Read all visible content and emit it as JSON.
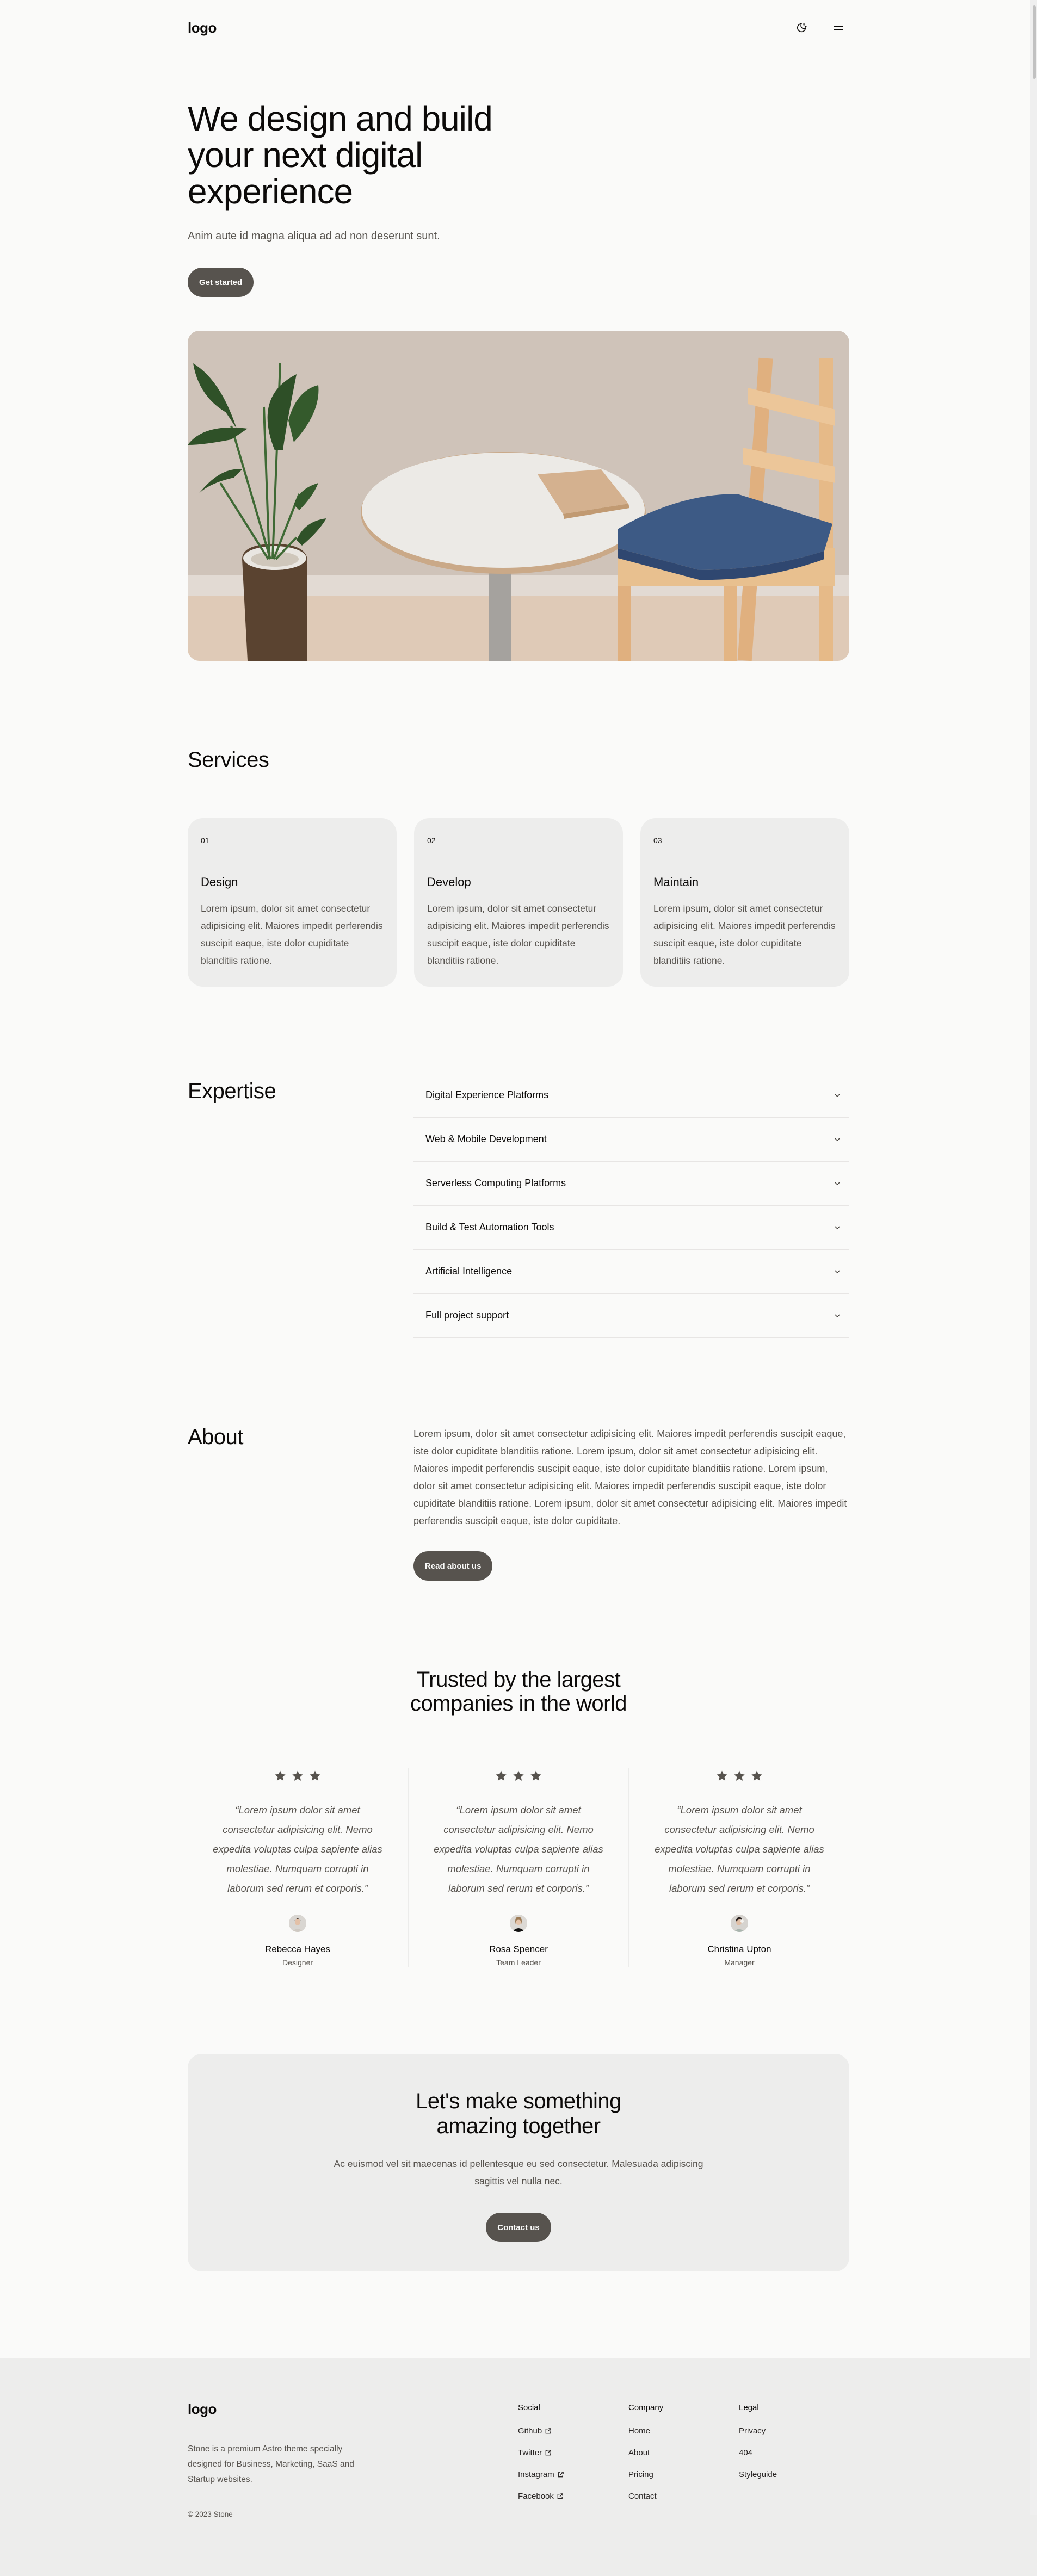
{
  "header": {
    "logo": "logo",
    "theme_toggle_icon": "moon-stars-icon",
    "menu_icon": "hamburger-menu-icon"
  },
  "hero": {
    "title": "We design and build your next digital experience",
    "subtitle": "Anim aute id magna aliqua ad ad non deserunt sunt.",
    "cta_label": "Get started",
    "image_alt": "Round white table with a closed laptop, a potted plant and a wooden chair with a blue cushion"
  },
  "services": {
    "title": "Services",
    "cards": [
      {
        "number": "01",
        "title": "Design",
        "body": "Lorem ipsum, dolor sit amet consectetur adipisicing elit. Maiores impedit perferendis suscipit eaque, iste dolor cupiditate blanditiis ratione."
      },
      {
        "number": "02",
        "title": "Develop",
        "body": "Lorem ipsum, dolor sit amet consectetur adipisicing elit. Maiores impedit perferendis suscipit eaque, iste dolor cupiditate blanditiis ratione."
      },
      {
        "number": "03",
        "title": "Maintain",
        "body": "Lorem ipsum, dolor sit amet consectetur adipisicing elit. Maiores impedit perferendis suscipit eaque, iste dolor cupiditate blanditiis ratione."
      }
    ]
  },
  "expertise": {
    "title": "Expertise",
    "items": [
      {
        "label": "Digital Experience Platforms"
      },
      {
        "label": "Web & Mobile Development"
      },
      {
        "label": "Serverless Computing Platforms"
      },
      {
        "label": "Build & Test Automation Tools"
      },
      {
        "label": "Artificial Intelligence"
      },
      {
        "label": "Full project support"
      }
    ]
  },
  "about": {
    "title": "About",
    "body": "Lorem ipsum, dolor sit amet consectetur adipisicing elit. Maiores impedit perferendis suscipit eaque, iste dolor cupiditate blanditiis ratione. Lorem ipsum, dolor sit amet consectetur adipisicing elit. Maiores impedit perferendis suscipit eaque, iste dolor cupiditate blanditiis ratione. Lorem ipsum, dolor sit amet consectetur adipisicing elit. Maiores impedit perferendis suscipit eaque, iste dolor cupiditate blanditiis ratione. Lorem ipsum, dolor sit amet consectetur adipisicing elit. Maiores impedit perferendis suscipit eaque, iste dolor cupiditate.",
    "cta_label": "Read about us"
  },
  "testimonials": {
    "title": "Trusted by the largest companies in the world",
    "items": [
      {
        "rating": 3,
        "quote": "“Lorem ipsum dolor sit amet consectetur adipisicing elit. Nemo expedita voluptas culpa sapiente alias molestiae. Numquam corrupti in laborum sed rerum et corporis.”",
        "name": "Rebecca Hayes",
        "role": "Designer"
      },
      {
        "rating": 3,
        "quote": "“Lorem ipsum dolor sit amet consectetur adipisicing elit. Nemo expedita voluptas culpa sapiente alias molestiae. Numquam corrupti in laborum sed rerum et corporis.”",
        "name": "Rosa Spencer",
        "role": "Team Leader"
      },
      {
        "rating": 3,
        "quote": "“Lorem ipsum dolor sit amet consectetur adipisicing elit. Nemo expedita voluptas culpa sapiente alias molestiae. Numquam corrupti in laborum sed rerum et corporis.”",
        "name": "Christina Upton",
        "role": "Manager"
      }
    ]
  },
  "cta": {
    "title": "Let's make something amazing together",
    "body": "Ac euismod vel sit maecenas id pellentesque eu sed consectetur. Malesuada adipiscing sagittis vel nulla nec.",
    "button_label": "Contact us"
  },
  "footer": {
    "logo": "logo",
    "description": "Stone is a premium Astro theme specially designed for Business, Marketing, SaaS and Startup websites.",
    "copyright": "© 2023 Stone",
    "columns": [
      {
        "title": "Social",
        "links": [
          {
            "label": "Github",
            "external": true
          },
          {
            "label": "Twitter",
            "external": true
          },
          {
            "label": "Instagram",
            "external": true
          },
          {
            "label": "Facebook",
            "external": true
          }
        ]
      },
      {
        "title": "Company",
        "links": [
          {
            "label": "Home"
          },
          {
            "label": "About"
          },
          {
            "label": "Pricing"
          },
          {
            "label": "Contact"
          }
        ]
      },
      {
        "title": "Legal",
        "links": [
          {
            "label": "Privacy"
          },
          {
            "label": "404"
          },
          {
            "label": "Styleguide"
          }
        ]
      }
    ]
  },
  "colors": {
    "background": "#fafaf9",
    "surface": "#ededec",
    "button": "#57534e",
    "text": "#0c0a09",
    "muted_text": "#57534e",
    "divider": "#e7e5e4"
  }
}
